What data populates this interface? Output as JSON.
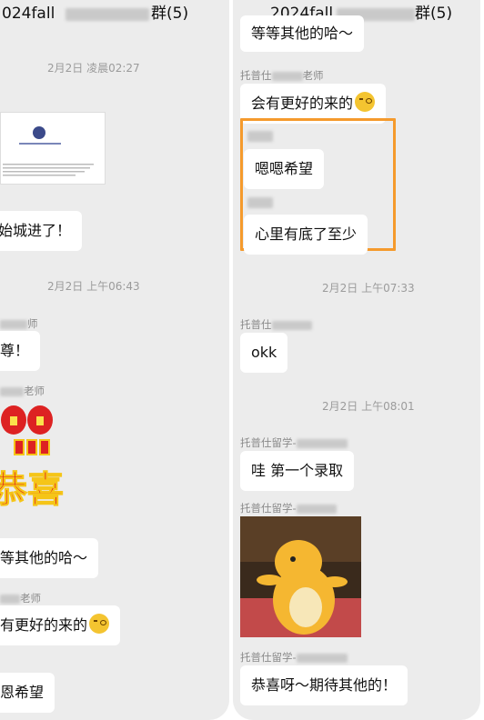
{
  "left": {
    "title_visible": "024fall",
    "title_suffix": "群(5)",
    "timestamp_1": "2月2日 凌晨02:27",
    "msg_city": "始城进了！",
    "timestamp_2": "2月2日 上午06:43",
    "sender_a": "师",
    "msg_excl": "尊！",
    "sender_b": "老师",
    "sticker_text": "恭喜",
    "msg_wait": "等其他的哈～",
    "sender_c": "老师",
    "msg_better": "有更好的来的",
    "msg_hope": "恩希望"
  },
  "right": {
    "title_visible": "2024fall",
    "title_suffix": "群(5)",
    "msg_wait_top": "等等其他的哈～",
    "sender_teacher": "托普仕",
    "sender_teacher_suffix": "老师",
    "msg_better": "会有更好的来的",
    "msg_hope": "嗯嗯希望",
    "msg_confident": "心里有底了至少",
    "timestamp_1": "2月2日 上午07:33",
    "sender_top": "托普仕",
    "msg_okk": "okk",
    "timestamp_2": "2月2日 上午08:01",
    "sender_study_1": "托普仕留学-",
    "msg_first": "哇 第一个录取",
    "sender_study_2": "托普仕留学-",
    "sender_study_3": "托普仕留学-",
    "msg_congrats": "恭喜呀～期待其他的！"
  },
  "colors": {
    "highlight": "#f59a2c",
    "bubble": "#ffffff",
    "background": "#ececec"
  },
  "icons": [
    "smirk-emoji-icon",
    "university-crest-icon",
    "firecracker-sticker",
    "yellow-dinosaur-sticker"
  ]
}
